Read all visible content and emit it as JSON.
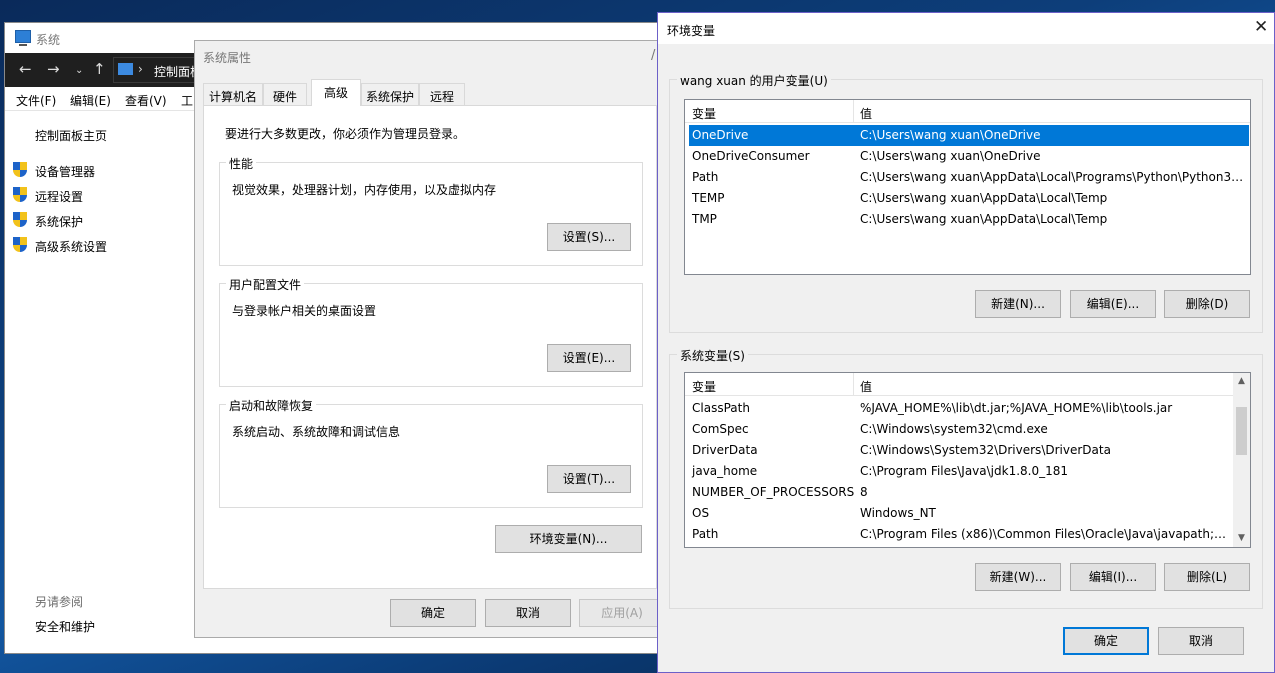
{
  "system_window": {
    "title": "系统",
    "address": "控制面板",
    "menu": [
      "文件(F)",
      "编辑(E)",
      "查看(V)",
      "工"
    ],
    "sidebar_home": "控制面板主页",
    "sidebar_items": [
      "设备管理器",
      "远程设置",
      "系统保护",
      "高级系统设置"
    ],
    "see_also_header": "另请参阅",
    "see_also_link": "安全和维护"
  },
  "system_properties": {
    "title": "系统属性",
    "tabs": [
      "计算机名",
      "硬件",
      "高级",
      "系统保护",
      "远程"
    ],
    "admin_note": "要进行大多数更改，你必须作为管理员登录。",
    "performance": {
      "title": "性能",
      "desc": "视觉效果，处理器计划，内存使用，以及虚拟内存",
      "button": "设置(S)..."
    },
    "user_profiles": {
      "title": "用户配置文件",
      "desc": "与登录帐户相关的桌面设置",
      "button": "设置(E)..."
    },
    "startup_recovery": {
      "title": "启动和故障恢复",
      "desc": "系统启动、系统故障和调试信息",
      "button": "设置(T)..."
    },
    "env_button": "环境变量(N)...",
    "ok": "确定",
    "cancel": "取消",
    "apply": "应用(A)"
  },
  "env_window": {
    "title": "环境变量",
    "user_vars": {
      "title": "wang xuan 的用户变量(U)",
      "col_var": "变量",
      "col_val": "值",
      "rows": [
        {
          "name": "OneDrive",
          "value": "C:\\Users\\wang xuan\\OneDrive"
        },
        {
          "name": "OneDriveConsumer",
          "value": "C:\\Users\\wang xuan\\OneDrive"
        },
        {
          "name": "Path",
          "value": "C:\\Users\\wang xuan\\AppData\\Local\\Programs\\Python\\Python37..."
        },
        {
          "name": "TEMP",
          "value": "C:\\Users\\wang xuan\\AppData\\Local\\Temp"
        },
        {
          "name": "TMP",
          "value": "C:\\Users\\wang xuan\\AppData\\Local\\Temp"
        }
      ],
      "new": "新建(N)...",
      "edit": "编辑(E)...",
      "delete": "删除(D)"
    },
    "system_vars": {
      "title": "系统变量(S)",
      "col_var": "变量",
      "col_val": "值",
      "rows": [
        {
          "name": "ClassPath",
          "value": "%JAVA_HOME%\\lib\\dt.jar;%JAVA_HOME%\\lib\\tools.jar"
        },
        {
          "name": "ComSpec",
          "value": "C:\\Windows\\system32\\cmd.exe"
        },
        {
          "name": "DriverData",
          "value": "C:\\Windows\\System32\\Drivers\\DriverData"
        },
        {
          "name": "java_home",
          "value": "C:\\Program Files\\Java\\jdk1.8.0_181"
        },
        {
          "name": "NUMBER_OF_PROCESSORS",
          "value": "8"
        },
        {
          "name": "OS",
          "value": "Windows_NT"
        },
        {
          "name": "Path",
          "value": "C:\\Program Files (x86)\\Common Files\\Oracle\\Java\\javapath;C:..."
        }
      ],
      "new": "新建(W)...",
      "edit": "编辑(I)...",
      "delete": "删除(L)"
    },
    "ok": "确定",
    "cancel": "取消"
  },
  "colors": {
    "selection": "#0078d7",
    "env_border": "#6c60c8",
    "nav_dark": "#1f1f1f"
  },
  "icons": [
    "computer-icon",
    "back-arrow-icon",
    "forward-arrow-icon",
    "dropdown-icon",
    "up-arrow-icon",
    "uac-shield-icon",
    "close-icon",
    "scroll-up-icon",
    "scroll-down-icon"
  ]
}
